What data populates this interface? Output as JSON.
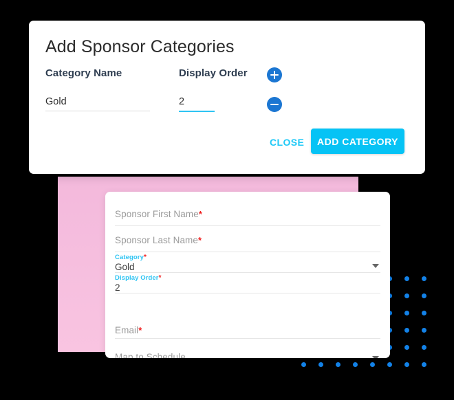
{
  "colors": {
    "primary_cyan": "#06c3f5",
    "link_cyan": "#20c9f7",
    "label_cyan": "#2ec4f3",
    "icon_blue": "#1b76d2",
    "dot_blue": "#1382e8",
    "pink_block": "#f6bcdd",
    "required_red": "#f02020"
  },
  "modal": {
    "title": "Add Sponsor Categories",
    "columns": [
      {
        "label": "Category Name"
      },
      {
        "label": "Display Order"
      }
    ],
    "add_row_icon": "plus-circle-icon",
    "remove_row_icon": "minus-circle-icon",
    "rows": [
      {
        "category_name": "Gold",
        "category_name_placeholder": "Category Name",
        "display_order": "2",
        "display_order_placeholder": "Display Order"
      }
    ],
    "actions": {
      "close_label": "CLOSE",
      "submit_label": "ADD CATEGORY"
    }
  },
  "form_card": {
    "fields": [
      {
        "name": "sponsor-first-name",
        "placeholder": "Sponsor First Name",
        "required": true,
        "value": "",
        "label": "",
        "type": "text"
      },
      {
        "name": "sponsor-last-name",
        "placeholder": "Sponsor Last Name",
        "required": true,
        "value": "",
        "label": "",
        "type": "text"
      },
      {
        "name": "category",
        "placeholder": "Category",
        "required": true,
        "value": "Gold",
        "label": "Category",
        "type": "select"
      },
      {
        "name": "display-order",
        "placeholder": "Display Order",
        "required": true,
        "value": "2",
        "label": "Display Order",
        "type": "text"
      },
      {
        "name": "email",
        "placeholder": "Email",
        "required": true,
        "value": "",
        "label": "",
        "type": "text"
      },
      {
        "name": "map-to-schedule",
        "placeholder": "Map to Schedule",
        "required": false,
        "value": "",
        "label": "",
        "type": "select"
      }
    ],
    "required_marker": "*",
    "dropdown_icon": "chevron-down-icon"
  },
  "decor": {
    "dot_grid": {
      "columns": 8,
      "rows": 6,
      "spacing_px": 25,
      "dot_size_px": 7
    }
  }
}
